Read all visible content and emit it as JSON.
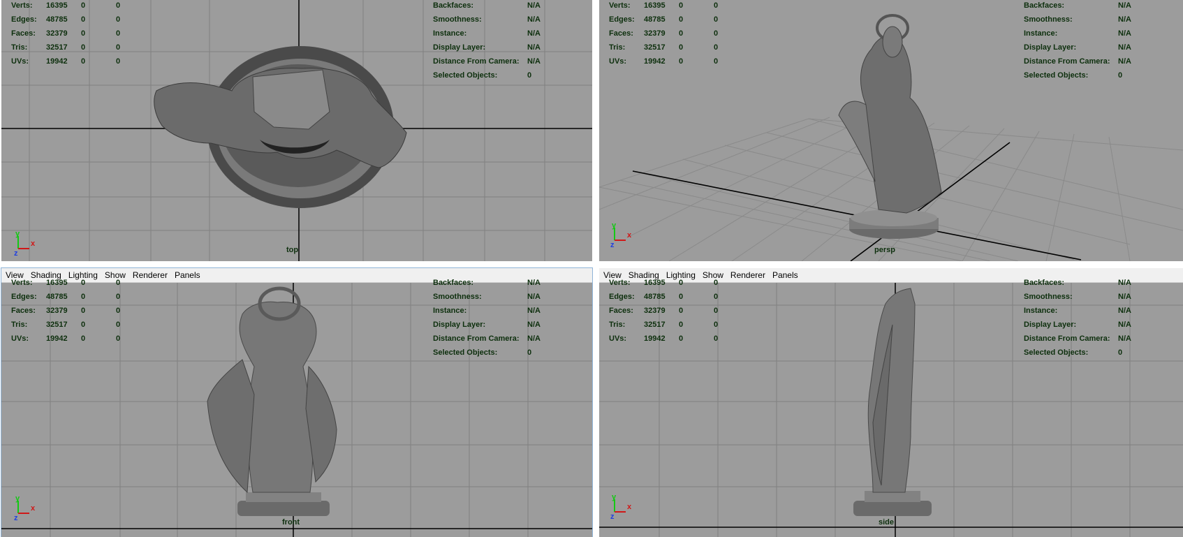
{
  "menu": [
    "View",
    "Shading",
    "Lighting",
    "Show",
    "Renderer",
    "Panels"
  ],
  "hud_left": [
    {
      "label": "Verts:",
      "v1": "16395",
      "v2": "0",
      "v3": "0"
    },
    {
      "label": "Edges:",
      "v1": "48785",
      "v2": "0",
      "v3": "0"
    },
    {
      "label": "Faces:",
      "v1": "32379",
      "v2": "0",
      "v3": "0"
    },
    {
      "label": "Tris:",
      "v1": "32517",
      "v2": "0",
      "v3": "0"
    },
    {
      "label": "UVs:",
      "v1": "19942",
      "v2": "0",
      "v3": "0"
    }
  ],
  "hud_right": [
    {
      "label": "Backfaces:",
      "value": "N/A"
    },
    {
      "label": "Smoothness:",
      "value": "N/A"
    },
    {
      "label": "Instance:",
      "value": "N/A"
    },
    {
      "label": "Display Layer:",
      "value": "N/A"
    },
    {
      "label": "Distance From Camera:",
      "value": "N/A"
    },
    {
      "label": "Selected Objects:",
      "value": "0"
    }
  ],
  "panels": {
    "top": {
      "camera": "top"
    },
    "persp": {
      "camera": "persp"
    },
    "front": {
      "camera": "front"
    },
    "side": {
      "camera": "side"
    }
  },
  "axis": {
    "x": "x",
    "y": "y",
    "z": "z"
  },
  "colors": {
    "viewport_bg": "#9c9c9c",
    "grid": "#7d7d7d",
    "hud_text": "#0d2f0d",
    "axis_x": "#d01818",
    "axis_y": "#14c814",
    "axis_z": "#2040e0"
  }
}
